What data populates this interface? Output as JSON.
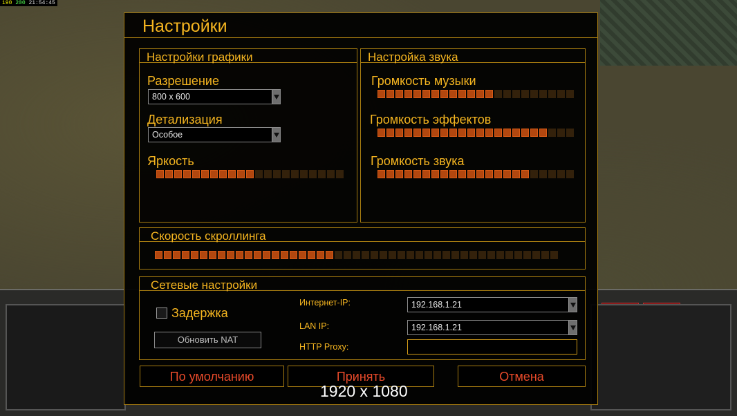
{
  "debug": {
    "fps": "190",
    "val": "200",
    "time": "21:54:45"
  },
  "dialog": {
    "title": "Настройки"
  },
  "graphics": {
    "title": "Настройки графики",
    "resolution_label": "Разрешение",
    "resolution_value": "800 x 600",
    "detail_label": "Детализация",
    "detail_value": "Особое",
    "brightness_label": "Яркость",
    "brightness": {
      "filled": 11,
      "total": 21
    }
  },
  "sound": {
    "title": "Настройка звука",
    "music_label": "Громкость музыки",
    "music": {
      "filled": 13,
      "total": 22
    },
    "effects_label": "Громкость эффектов",
    "effects": {
      "filled": 19,
      "total": 22
    },
    "voice_label": "Громкость звука",
    "voice": {
      "filled": 17,
      "total": 22
    }
  },
  "scroll": {
    "title": "Скорость скроллинга",
    "speed": {
      "filled": 20,
      "total": 45
    }
  },
  "network": {
    "title": "Сетевые настройки",
    "delay_label": "Задержка",
    "delay_checked": false,
    "refresh_nat_label": "Обновить NAT",
    "internet_ip_label": "Интернет-IP:",
    "internet_ip_value": "192.168.1.21",
    "lan_ip_label": "LAN IP:",
    "lan_ip_value": "192.168.1.21",
    "http_proxy_label": "HTTP Proxy:",
    "http_proxy_value": ""
  },
  "buttons": {
    "defaults": "По умолчанию",
    "accept": "Принять",
    "cancel": "Отмена"
  },
  "overlay": {
    "resolution_text": "1920 x 1080"
  },
  "colors": {
    "accent": "#f5b520",
    "border": "#a77c10",
    "button_text": "#e84a2a",
    "slider_on": "#b2470f",
    "slider_off": "#33210b"
  }
}
